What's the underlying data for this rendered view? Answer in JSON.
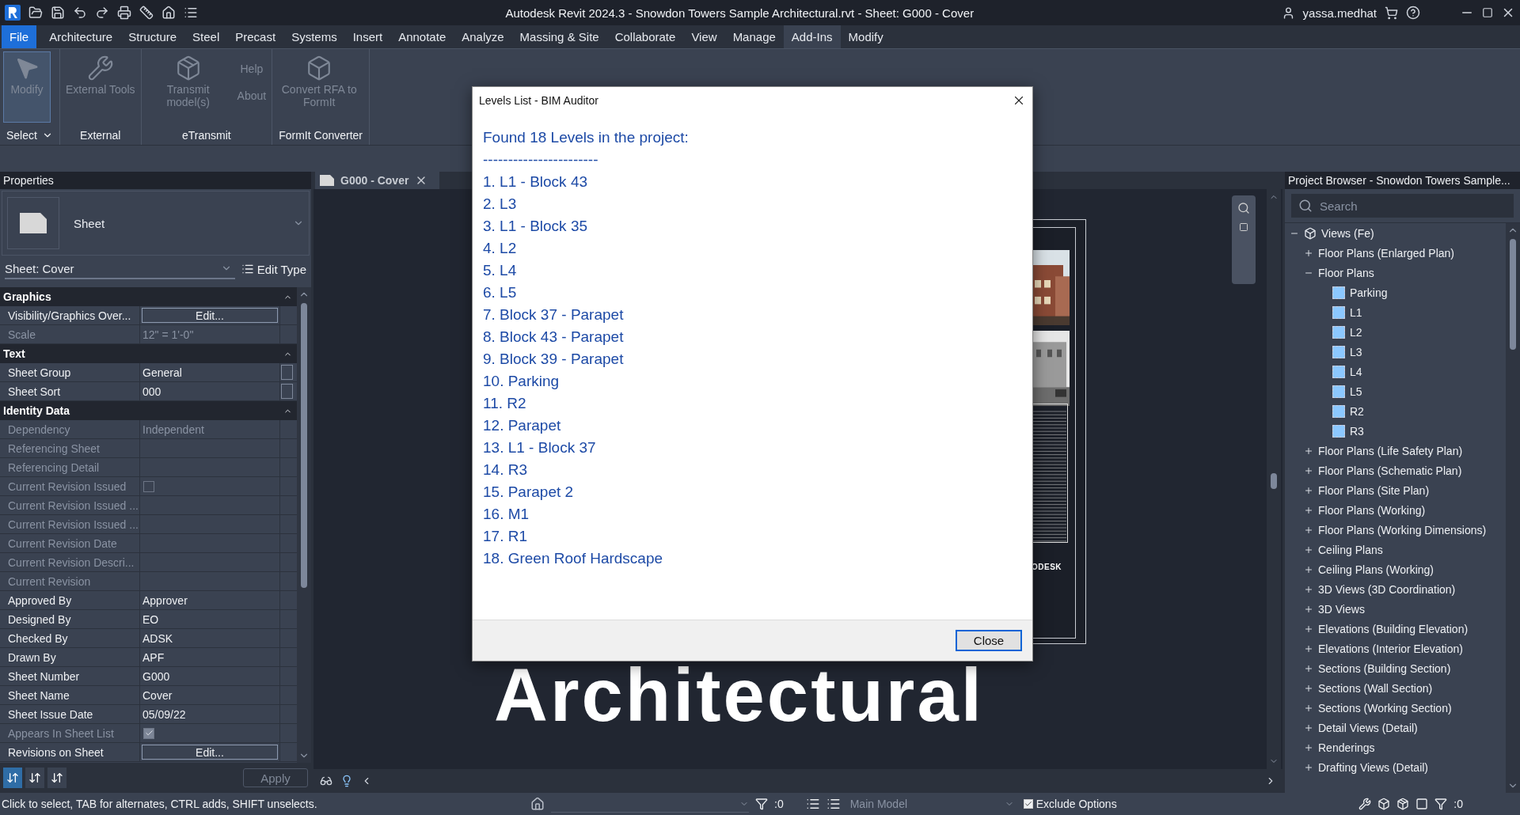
{
  "window": {
    "title": "Autodesk Revit 2024.3 - Snowdon Towers Sample Architectural.rvt - Sheet: G000 - Cover",
    "user": "yassa.medhat"
  },
  "ribbon": {
    "tabs": [
      {
        "label": "File",
        "kind": "file",
        "selected": false
      },
      {
        "label": "Architecture",
        "kind": "tab",
        "selected": false
      },
      {
        "label": "Structure",
        "kind": "tab",
        "selected": false
      },
      {
        "label": "Steel",
        "kind": "tab",
        "selected": false
      },
      {
        "label": "Precast",
        "kind": "tab",
        "selected": false
      },
      {
        "label": "Systems",
        "kind": "tab",
        "selected": false
      },
      {
        "label": "Insert",
        "kind": "tab",
        "selected": false
      },
      {
        "label": "Annotate",
        "kind": "tab",
        "selected": false
      },
      {
        "label": "Analyze",
        "kind": "tab",
        "selected": false
      },
      {
        "label": "Massing & Site",
        "kind": "tab",
        "selected": false
      },
      {
        "label": "Collaborate",
        "kind": "tab",
        "selected": false
      },
      {
        "label": "View",
        "kind": "tab",
        "selected": false
      },
      {
        "label": "Manage",
        "kind": "tab",
        "selected": false
      },
      {
        "label": "Add-Ins",
        "kind": "tab",
        "selected": true
      },
      {
        "label": "Modify",
        "kind": "tab",
        "selected": false
      }
    ],
    "panels": [
      {
        "label": "Select",
        "dropdown": true,
        "tools": [
          {
            "label": "Modify",
            "kind": "pointer",
            "disabled": true,
            "selected": true
          }
        ]
      },
      {
        "label": "External",
        "dropdown": false,
        "tools": [
          {
            "label": "External Tools",
            "kind": "wrench",
            "disabled": true,
            "selected": false
          }
        ]
      },
      {
        "label": "eTransmit",
        "dropdown": false,
        "tools": [
          {
            "label": "Transmit model(s)",
            "kind": "transmit",
            "disabled": true,
            "selected": false
          },
          {
            "label": "Help",
            "kind": "small",
            "disabled": true,
            "selected": false
          },
          {
            "label": "About",
            "kind": "small",
            "disabled": true,
            "selected": false
          }
        ]
      },
      {
        "label": "FormIt Converter",
        "dropdown": false,
        "tools": [
          {
            "label": "Convert RFA to FormIt",
            "kind": "convert",
            "disabled": true,
            "selected": false
          }
        ]
      }
    ]
  },
  "properties": {
    "title": "Properties",
    "type_name": "Sheet",
    "instance": "Sheet: Cover",
    "edit_type": "Edit Type",
    "apply": "Apply",
    "groups": [
      {
        "title": "Graphics",
        "expanded": true,
        "rows": [
          {
            "label": "Visibility/Graphics Over...",
            "kind": "button",
            "value": "Edit...",
            "disabled": false
          },
          {
            "label": "Scale",
            "kind": "text",
            "value": "12\" = 1'-0\"",
            "disabled": true
          }
        ]
      },
      {
        "title": "Text",
        "expanded": true,
        "rows": [
          {
            "label": "Sheet Group",
            "kind": "text",
            "value": "General",
            "disabled": false,
            "browse": true
          },
          {
            "label": "Sheet Sort",
            "kind": "text",
            "value": "000",
            "disabled": false,
            "browse": true
          }
        ]
      },
      {
        "title": "Identity Data",
        "expanded": true,
        "rows": [
          {
            "label": "Dependency",
            "kind": "text",
            "value": "Independent",
            "disabled": true
          },
          {
            "label": "Referencing Sheet",
            "kind": "text",
            "disabled": true
          },
          {
            "label": "Referencing Detail",
            "kind": "text",
            "disabled": true
          },
          {
            "label": "Current Revision Issued",
            "kind": "checkbox",
            "checked": false,
            "disabled": true
          },
          {
            "label": "Current Revision Issued ...",
            "kind": "text",
            "disabled": true
          },
          {
            "label": "Current Revision Issued ...",
            "kind": "text",
            "disabled": true
          },
          {
            "label": "Current Revision Date",
            "kind": "text",
            "disabled": true
          },
          {
            "label": "Current Revision Descri...",
            "kind": "text",
            "disabled": true
          },
          {
            "label": "Current Revision",
            "kind": "text",
            "disabled": true
          },
          {
            "label": "Approved By",
            "kind": "text",
            "value": "Approver",
            "disabled": false
          },
          {
            "label": "Designed By",
            "kind": "text",
            "value": "EO",
            "disabled": false
          },
          {
            "label": "Checked By",
            "kind": "text",
            "value": "ADSK",
            "disabled": false
          },
          {
            "label": "Drawn By",
            "kind": "text",
            "value": "APF",
            "disabled": false
          },
          {
            "label": "Sheet Number",
            "kind": "text",
            "value": "G000",
            "disabled": false
          },
          {
            "label": "Sheet Name",
            "kind": "text",
            "value": "Cover",
            "disabled": false
          },
          {
            "label": "Sheet Issue Date",
            "kind": "text",
            "value": "05/09/22",
            "disabled": false
          },
          {
            "label": "Appears In Sheet List",
            "kind": "checkbox",
            "checked": true,
            "disabled": true
          },
          {
            "label": "Revisions on Sheet",
            "kind": "button",
            "value": "Edit...",
            "disabled": false
          }
        ]
      }
    ]
  },
  "view": {
    "tab": "G000 - Cover",
    "sheet_title": "Architectural",
    "sheet_logo": "ODESK"
  },
  "dialog": {
    "title": "Levels List - BIM Auditor",
    "heading": "Found 18 Levels in the project:",
    "separator": "-----------------------",
    "close": "Close",
    "items": [
      "1. L1 - Block 43",
      "2. L3",
      "3. L1 - Block 35",
      "4. L2",
      "5. L4",
      "6. L5",
      "7. Block 37 - Parapet",
      "8. Block 43 - Parapet",
      "9. Block 39 - Parapet",
      "10. Parking",
      "11. R2",
      "12. Parapet",
      "13. L1 - Block 37",
      "14. R3",
      "15. Parapet 2",
      "16. M1",
      "17. R1",
      "18. Green Roof Hardscape"
    ]
  },
  "project_browser": {
    "title": "Project Browser - Snowdon Towers Sample...",
    "search_placeholder": "Search",
    "tree": [
      {
        "label": "Views (Fe)",
        "kind": "root",
        "expanded": true,
        "children": [
          {
            "label": "Floor Plans (Enlarged Plan)",
            "kind": "group",
            "expanded": false
          },
          {
            "label": "Floor Plans",
            "kind": "group",
            "expanded": true,
            "children": [
              {
                "label": "Parking",
                "kind": "view"
              },
              {
                "label": "L1",
                "kind": "view"
              },
              {
                "label": "L2",
                "kind": "view"
              },
              {
                "label": "L3",
                "kind": "view"
              },
              {
                "label": "L4",
                "kind": "view"
              },
              {
                "label": "L5",
                "kind": "view"
              },
              {
                "label": "R2",
                "kind": "view"
              },
              {
                "label": "R3",
                "kind": "view"
              }
            ]
          },
          {
            "label": "Floor Plans (Life Safety Plan)",
            "kind": "group",
            "expanded": false
          },
          {
            "label": "Floor Plans (Schematic Plan)",
            "kind": "group",
            "expanded": false
          },
          {
            "label": "Floor Plans (Site Plan)",
            "kind": "group",
            "expanded": false
          },
          {
            "label": "Floor Plans (Working)",
            "kind": "group",
            "expanded": false
          },
          {
            "label": "Floor Plans (Working Dimensions)",
            "kind": "group",
            "expanded": false
          },
          {
            "label": "Ceiling Plans",
            "kind": "group",
            "expanded": false
          },
          {
            "label": "Ceiling Plans (Working)",
            "kind": "group",
            "expanded": false
          },
          {
            "label": "3D Views (3D Coordination)",
            "kind": "group",
            "expanded": false
          },
          {
            "label": "3D Views",
            "kind": "group",
            "expanded": false
          },
          {
            "label": "Elevations (Building Elevation)",
            "kind": "group",
            "expanded": false
          },
          {
            "label": "Elevations (Interior Elevation)",
            "kind": "group",
            "expanded": false
          },
          {
            "label": "Sections (Building Section)",
            "kind": "group",
            "expanded": false
          },
          {
            "label": "Sections (Wall Section)",
            "kind": "group",
            "expanded": false
          },
          {
            "label": "Sections (Working Section)",
            "kind": "group",
            "expanded": false
          },
          {
            "label": "Detail Views (Detail)",
            "kind": "group",
            "expanded": false
          },
          {
            "label": "Renderings",
            "kind": "group",
            "expanded": false
          },
          {
            "label": "Drafting Views (Detail)",
            "kind": "group",
            "expanded": false
          }
        ]
      }
    ]
  },
  "status_bar": {
    "message": "Click to select, TAB for alternates, CTRL adds, SHIFT unselects.",
    "workset_count": ":0",
    "model": "Main Model",
    "exclude_options": {
      "label": "Exclude Options",
      "checked": true
    },
    "filter_count": ":0"
  }
}
